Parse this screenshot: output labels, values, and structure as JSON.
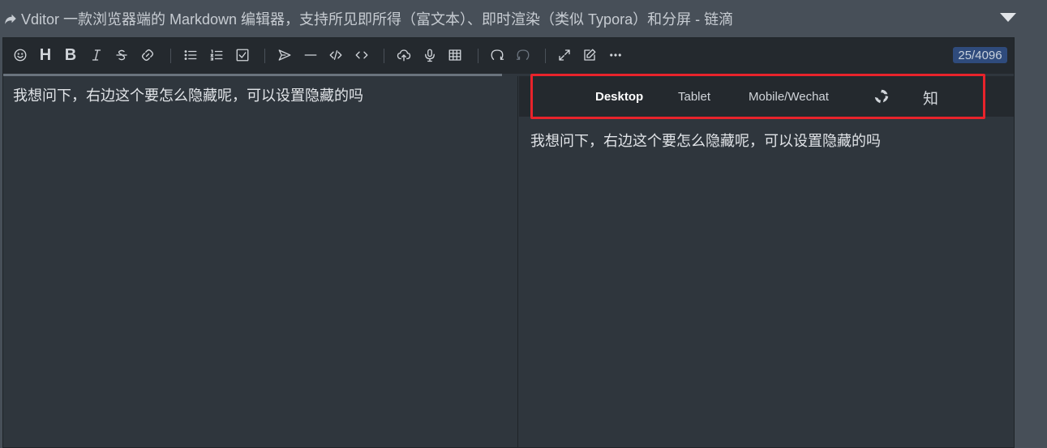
{
  "window": {
    "title": "Vditor 一款浏览器端的 Markdown 编辑器，支持所见即所得（富文本）、即时渲染（类似 Typora）和分屏 - 链滴"
  },
  "toolbar": {
    "heading_label": "H",
    "bold_label": "B",
    "counter": "25/4096"
  },
  "editor": {
    "content": "我想问下，右边这个要怎么隐藏呢，可以设置隐藏的吗"
  },
  "preview": {
    "tabs": [
      {
        "label": "Desktop",
        "active": true
      },
      {
        "label": "Tablet",
        "active": false
      },
      {
        "label": "Mobile/Wechat",
        "active": false
      }
    ],
    "zhihu_label": "知",
    "content": "我想问下，右边这个要怎么隐藏呢，可以设置隐藏的吗"
  },
  "colors": {
    "highlight_border": "#e8232b",
    "counter_bg": "#2f4b7c"
  }
}
